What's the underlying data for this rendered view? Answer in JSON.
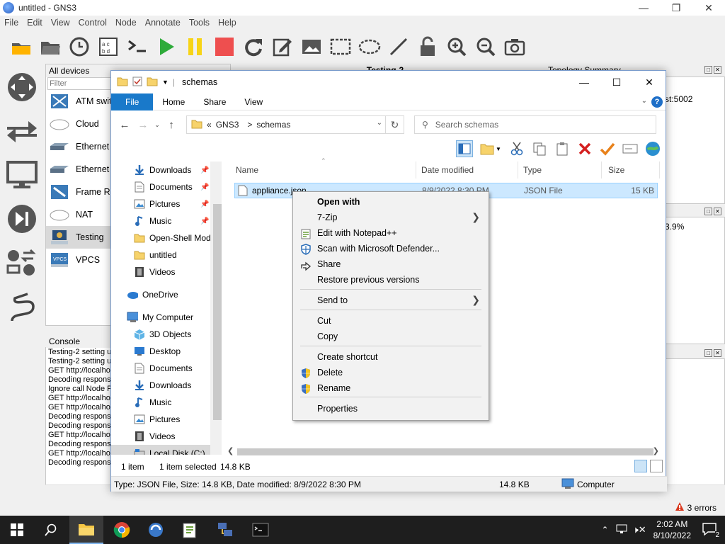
{
  "gns3": {
    "title": "untitled - GNS3",
    "menu": [
      "File",
      "Edit",
      "View",
      "Control",
      "Node",
      "Annotate",
      "Tools",
      "Help"
    ],
    "devices_title": "All devices",
    "filter_placeholder": "Filter",
    "devices": [
      "ATM swit",
      "Cloud",
      "Ethernet h",
      "Ethernet s",
      "Frame Re",
      "NAT",
      "Testing",
      "VPCS"
    ],
    "center_title": "Testing-2",
    "topology_title": "Topology Summary",
    "topology_text": "st:5002",
    "cpu_text": "3.9%",
    "console_title": "Console",
    "console_lines": [
      "Testing-2 setting u",
      "Testing-2 setting u",
      "GET http://localho",
      "Decoding respons",
      "Ignore call Node P",
      "GET http://localho",
      "GET http://localho",
      "Decoding respons",
      "Decoding respons",
      "GET http://localho",
      "Decoding respons",
      "GET http://localho",
      "Decoding respons"
    ],
    "errors": "3 errors"
  },
  "explorer": {
    "title": "schemas",
    "tabs": [
      "File",
      "Home",
      "Share",
      "View"
    ],
    "help_label": "?",
    "address": [
      "«",
      "GNS3",
      ">",
      "schemas"
    ],
    "search_placeholder": "Search schemas",
    "nav": [
      {
        "label": "Downloads",
        "icon": "download-arrow-icon",
        "pinned": true,
        "indent": 1
      },
      {
        "label": "Documents",
        "icon": "document-icon",
        "pinned": true,
        "indent": 1
      },
      {
        "label": "Pictures",
        "icon": "picture-icon",
        "pinned": true,
        "indent": 1
      },
      {
        "label": "Music",
        "icon": "music-note-icon",
        "pinned": true,
        "indent": 1
      },
      {
        "label": "Open-Shell Mod",
        "icon": "folder-icon",
        "pinned": false,
        "indent": 1
      },
      {
        "label": "untitled",
        "icon": "folder-icon",
        "pinned": false,
        "indent": 1
      },
      {
        "label": "Videos",
        "icon": "film-icon",
        "pinned": false,
        "indent": 1
      },
      {
        "label": "",
        "icon": "",
        "pinned": false,
        "indent": 0
      },
      {
        "label": "OneDrive",
        "icon": "cloud-icon",
        "pinned": false,
        "indent": 0
      },
      {
        "label": "",
        "icon": "",
        "pinned": false,
        "indent": 0
      },
      {
        "label": "My Computer",
        "icon": "computer-icon",
        "pinned": false,
        "indent": 0
      },
      {
        "label": "3D Objects",
        "icon": "cube-icon",
        "pinned": false,
        "indent": 1
      },
      {
        "label": "Desktop",
        "icon": "desktop-icon",
        "pinned": false,
        "indent": 1
      },
      {
        "label": "Documents",
        "icon": "document-icon",
        "pinned": false,
        "indent": 1
      },
      {
        "label": "Downloads",
        "icon": "download-arrow-icon",
        "pinned": false,
        "indent": 1
      },
      {
        "label": "Music",
        "icon": "music-note-icon",
        "pinned": false,
        "indent": 1
      },
      {
        "label": "Pictures",
        "icon": "picture-icon",
        "pinned": false,
        "indent": 1
      },
      {
        "label": "Videos",
        "icon": "film-icon",
        "pinned": false,
        "indent": 1
      },
      {
        "label": "Local Disk (C:)",
        "icon": "drive-icon",
        "pinned": false,
        "indent": 1,
        "selected": true
      }
    ],
    "columns": [
      "Name",
      "Date modified",
      "Type",
      "Size"
    ],
    "file": {
      "name": "appliance.json",
      "date": "8/9/2022 8:30 PM",
      "type": "JSON File",
      "size": "15 KB"
    },
    "status_items": "1 item",
    "status_selected": "1 item selected",
    "status_size": "14.8 KB",
    "detail_text": "Type: JSON File, Size: 14.8 KB, Date modified: 8/9/2022 8:30 PM",
    "detail_size": "14.8 KB",
    "detail_location": "Computer"
  },
  "context_menu": {
    "items": [
      {
        "label": "Open with",
        "bold": true,
        "icon": "",
        "arrow": false
      },
      {
        "label": "7-Zip",
        "bold": false,
        "icon": "",
        "arrow": true
      },
      {
        "label": "Edit with Notepad++",
        "bold": false,
        "icon": "notepad-plus-icon",
        "arrow": false
      },
      {
        "label": "Scan with Microsoft Defender...",
        "bold": false,
        "icon": "defender-shield-icon",
        "arrow": false
      },
      {
        "label": "Share",
        "bold": false,
        "icon": "share-icon",
        "arrow": false
      },
      {
        "label": "Restore previous versions",
        "bold": false,
        "icon": "",
        "arrow": false
      },
      {
        "label": "Send to",
        "bold": false,
        "icon": "",
        "arrow": true
      },
      {
        "label": "Cut",
        "bold": false,
        "icon": "",
        "arrow": false
      },
      {
        "label": "Copy",
        "bold": false,
        "icon": "",
        "arrow": false
      },
      {
        "label": "Create shortcut",
        "bold": false,
        "icon": "",
        "arrow": false
      },
      {
        "label": "Delete",
        "bold": false,
        "icon": "uac-shield-icon",
        "arrow": false
      },
      {
        "label": "Rename",
        "bold": false,
        "icon": "uac-shield-icon",
        "arrow": false
      },
      {
        "label": "Properties",
        "bold": false,
        "icon": "",
        "arrow": false
      }
    ]
  },
  "taskbar": {
    "time": "2:02 AM",
    "date": "8/10/2022",
    "notification_count": "2"
  }
}
